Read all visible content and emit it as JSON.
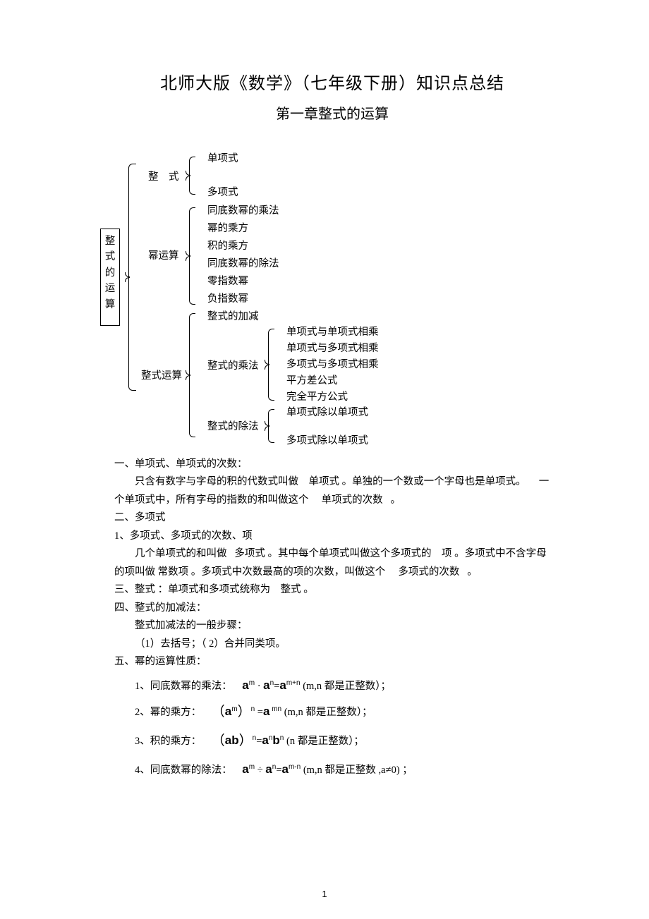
{
  "title": "北师大版《数学》（七年级下册）知识点总结",
  "chapter": "第一章整式的运算",
  "diagram": {
    "root": "整式的运算",
    "b1": {
      "label": "整　式",
      "items": [
        "单项式",
        "多项式"
      ]
    },
    "b2": {
      "label": "幂运算",
      "items": [
        "同底数幂的乘法",
        "幂的乘方",
        "积的乘方",
        "同底数幂的除法",
        "零指数幂",
        "负指数幂"
      ]
    },
    "b3": {
      "label": "整式运算",
      "top": "整式的加减",
      "mul": {
        "label": "整式的乘法",
        "items": [
          "单项式与单项式相乘",
          "单项式与多项式相乘",
          "多项式与多项式相乘",
          "平方差公式",
          "完全平方公式"
        ]
      },
      "div": {
        "label": "整式的除法",
        "items": [
          "单项式除以单项式",
          "多项式除以单项式"
        ]
      }
    }
  },
  "sec1_h": "一、单项式、单项式的次数：",
  "sec1_p1a": "只含有数字与字母的积的代数式叫做",
  "sec1_p1b": "单项式 。单独的一个数或一个字母也是单项式。",
  "sec1_p1c": "一",
  "sec1_p2a": "个单项式中，所有字母的指数的和叫做这个",
  "sec1_p2b": "单项式的次数",
  "sec1_p2c": "。",
  "sec2_h": "二、多项式",
  "sec2_s1": "1、多项式、多项式的次数、项",
  "sec2_p1a": "几个单项式的和叫做",
  "sec2_p1b": "多项式 。其中每个单项式叫做这个多项式的",
  "sec2_p1c": "项 。多项式中不含字母",
  "sec2_p2a": "的项叫做 常数项 。多项式中次数最高的项的次数，叫做这个",
  "sec2_p2b": "多项式的次数",
  "sec2_p2c": "。",
  "sec3": "三、整式 ：单项式和多项式统称为　整式 。",
  "sec4_h": "四、整式的加减法：",
  "sec4_p1": "整式加减法的一般步骤：",
  "sec4_p2": "（1）去括号；（ 2）合并同类项。",
  "sec5_h": "五、幂的运算性质：",
  "f1_pre": "1、同底数幂的乘法：",
  "f1_tail": "(m,n 都是正整数）；",
  "f2_pre": "2、幂的乘方：",
  "f2_tail": "(m,n 都是正整数）；",
  "f3_pre": "3、积的乘方：",
  "f3_tail": "(n 都是正整数）；",
  "f4_pre": "4、同底数幂的除法：",
  "f4_tail": "(m,n 都是正整数 ,a≠0) ；",
  "page_num": "1"
}
